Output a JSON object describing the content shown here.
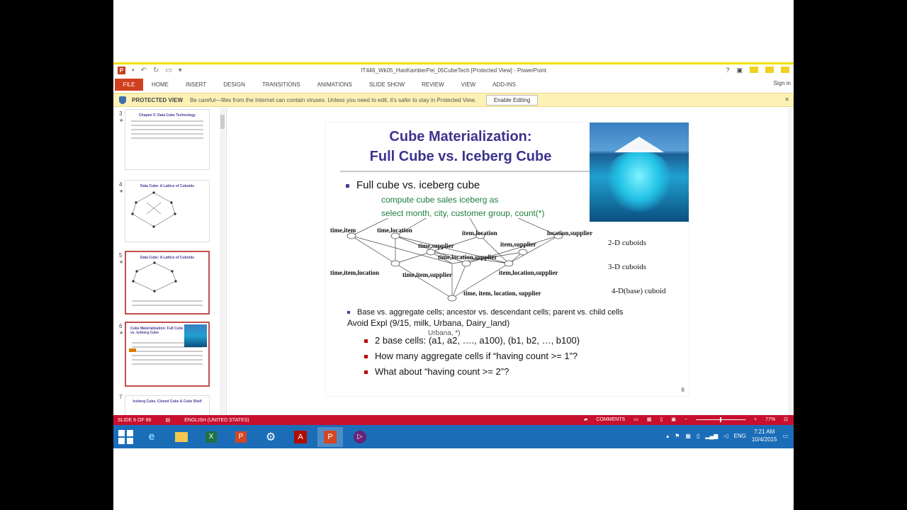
{
  "window": {
    "title": "IT446_Wk05_HanKamberPei_05CubeTech [Protected View] - PowerPoint",
    "sign_in": "Sign in"
  },
  "ribbon": {
    "file": "FILE",
    "tabs": [
      "HOME",
      "INSERT",
      "DESIGN",
      "TRANSITIONS",
      "ANIMATIONS",
      "SLIDE SHOW",
      "REVIEW",
      "VIEW",
      "ADD-INS"
    ]
  },
  "protected_view": {
    "label": "PROTECTED VIEW",
    "message": "Be careful—files from the Internet can contain viruses. Unless you need to edit, it's safer to stay in Protected View.",
    "button": "Enable Editing"
  },
  "thumbnails": [
    {
      "num": "3",
      "title": "Chapter 5: Data Cube Technology"
    },
    {
      "num": "4",
      "title": "Data Cube: A Lattice of Cuboids"
    },
    {
      "num": "5",
      "title": "Data Cube: A Lattice of Cuboids"
    },
    {
      "num": "6",
      "title": "Cube Materialization: Full Cube vs. Iceberg Cube"
    },
    {
      "num": "7",
      "title": "Iceberg Cube, Closed Cube & Cube Shell"
    }
  ],
  "slide": {
    "title_line1": "Cube Materialization:",
    "title_line2": "Full Cube vs. Iceberg Cube",
    "bullet1": "Full cube vs. iceberg cube",
    "code_line1": "compute cube sales iceberg as",
    "code_line2": "select month, city, customer group, count(*)",
    "lattice": {
      "nodes_2d": [
        "time,item",
        "time,location",
        "item,location",
        "location,supplier",
        "time,supplier",
        "item,supplier"
      ],
      "nodes_3d": [
        "time,item,location",
        "time,location,supplier",
        "time,item,supplier",
        "item,location,supplier"
      ],
      "node_4d": "time, item, location, supplier",
      "labels": [
        "2-D cuboids",
        "3-D cuboids",
        "4-D(base) cuboid"
      ]
    },
    "bullet2": "Base vs. aggregate cells; ancestor vs. descendant cells; parent vs. child cells",
    "overlap_text": "Avoid Expl (9/15, milk, Urbana, Dairy_land)",
    "overlap_text2": "Urbana, *)",
    "sub1_text": "2 base cells: (a1, a2, …., a100), (b1, b2, …, b100)",
    "sub2": "How many aggregate cells if “having count >= 1”?",
    "sub3": "What about “having count >= 2”?",
    "page_number": "6"
  },
  "status": {
    "slide": "SLIDE 6 OF 86",
    "language": "ENGLISH (UNITED STATES)",
    "comments": "COMMENTS",
    "zoom": "77%"
  },
  "taskbar": {
    "lang": "ENG",
    "time": "7:21 AM",
    "date": "10/4/2015"
  }
}
